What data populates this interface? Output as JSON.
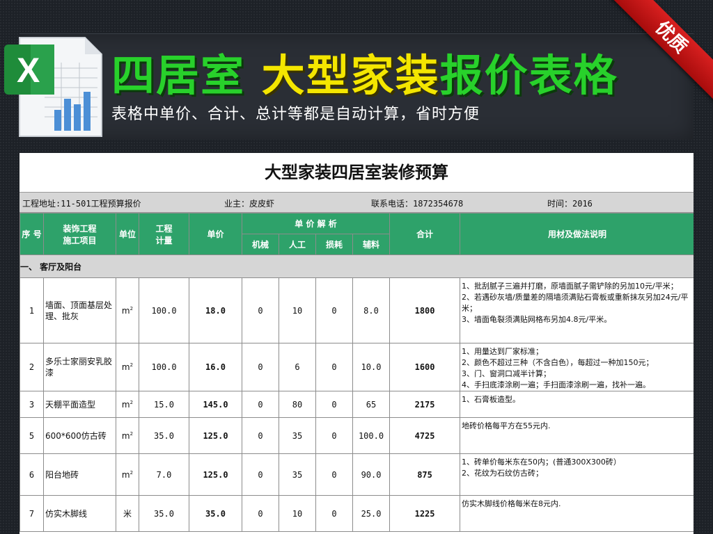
{
  "banner": {
    "title_green_1": "四居室",
    "title_yellow": "大型家装",
    "title_green_2": "报价表格",
    "subtitle": "表格中单价、合计、总计等都是自动计算，省时方便",
    "ribbon": "优质",
    "colors": {
      "green": "#28d12b",
      "yellow": "#f4e600",
      "ribbon": "#c81818"
    },
    "logo_icon": "excel-icon"
  },
  "sheet": {
    "title": "大型家装四居室装修预算",
    "info": {
      "address": "工程地址:11-501工程预算报价",
      "owner": "业主：皮皮虾",
      "phone": "联系电话：1872354678",
      "time": "时间：2016"
    },
    "headers": {
      "seq": "序 号",
      "item_1": "装饰工程",
      "item_2": "施工项目",
      "unit": "单位",
      "qty_1": "工程",
      "qty_2": "计量",
      "price": "单价",
      "breakdown": "单 价 解 析",
      "machine": "机械",
      "labor": "人工",
      "loss": "损耗",
      "aux": "辅料",
      "total": "合计",
      "notes": "用材及做法说明"
    },
    "section": "一、  客厅及阳台",
    "rows": [
      {
        "seq": "1",
        "item": "墙面、顶面基层处理、批灰",
        "unit": "m",
        "unit_sup": "2",
        "qty": "100.0",
        "price": "18.0",
        "machine": "0",
        "labor": "10",
        "loss": "0",
        "aux": "8.0",
        "total": "1800",
        "notes": [
          "1、批刮腻子三遍并打磨，原墙面腻子需铲除的另加10元/平米；",
          "2、若遇砂灰墙/质量差的隔墙须满贴石膏板或重新抹灰另加24元/平米；",
          "3、墙面龟裂须满贴网格布另加4.8元/平米。"
        ]
      },
      {
        "seq": "2",
        "item": "多乐士家丽安乳胶漆",
        "unit": "m",
        "unit_sup": "2",
        "qty": "100.0",
        "price": "16.0",
        "machine": "0",
        "labor": "6",
        "loss": "0",
        "aux": "10.0",
        "total": "1600",
        "notes": [
          "1、用量达到厂家标准；",
          "2、颜色不超过三种（不含白色），每超过一种加150元；",
          "3、门、窗洞口减半计算；",
          "4、手扫底漆涂刷一遍；手扫面漆涂刷一遍，找补一遍。"
        ]
      },
      {
        "seq": "3",
        "item": "天棚平面造型",
        "unit": "m",
        "unit_sup": "2",
        "qty": "15.0",
        "price": "145.0",
        "machine": "0",
        "labor": "80",
        "loss": "0",
        "aux": "65",
        "total": "2175",
        "notes": [
          "1、石膏板造型。"
        ]
      },
      {
        "seq": "5",
        "item": "600*600仿古砖",
        "unit": "m",
        "unit_sup": "2",
        "qty": "35.0",
        "price": "125.0",
        "machine": "0",
        "labor": "35",
        "loss": "0",
        "aux": "100.0",
        "total": "4725",
        "notes": [
          "地砖价格每平方在55元内."
        ]
      },
      {
        "seq": "6",
        "item": "阳台地砖",
        "unit": "m",
        "unit_sup": "2",
        "qty": "7.0",
        "price": "125.0",
        "machine": "0",
        "labor": "35",
        "loss": "0",
        "aux": "90.0",
        "total": "875",
        "notes": [
          "1、砖单价每米东在50内；(普通300X300砖）",
          "2、花纹为石纹仿古砖；"
        ]
      },
      {
        "seq": "7",
        "item": "仿实木脚线",
        "unit": "米",
        "unit_sup": "",
        "qty": "35.0",
        "price": "35.0",
        "machine": "0",
        "labor": "10",
        "loss": "0",
        "aux": "25.0",
        "total": "1225",
        "notes": [
          "仿实木脚线价格每米在8元内."
        ]
      }
    ]
  }
}
